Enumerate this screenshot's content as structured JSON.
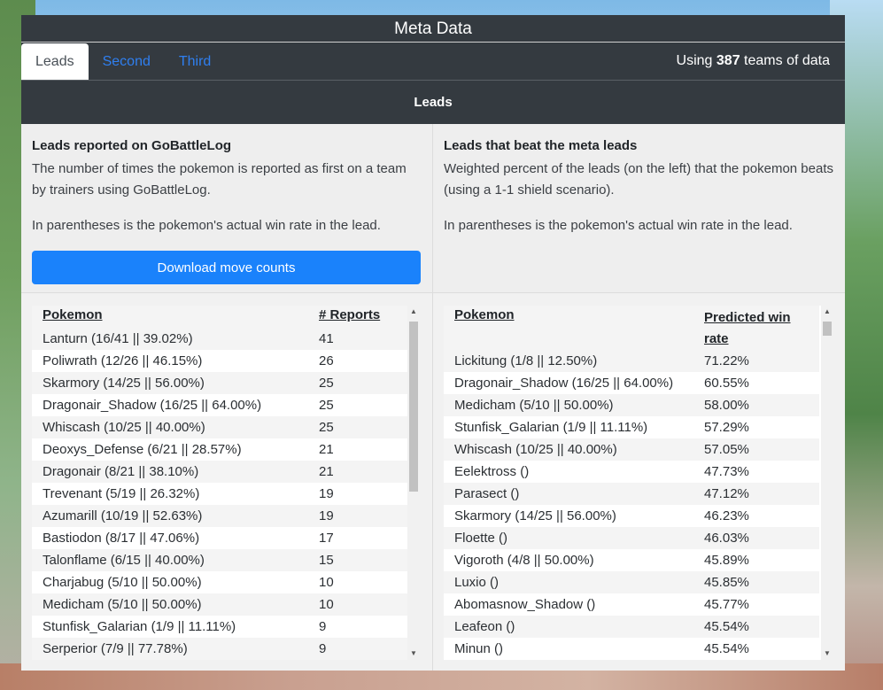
{
  "header": {
    "title": "Meta Data"
  },
  "tabs": [
    {
      "label": "Leads"
    },
    {
      "label": "Second"
    },
    {
      "label": "Third"
    }
  ],
  "teams_info": {
    "prefix": "Using",
    "count": "387",
    "suffix": "teams of data"
  },
  "section": {
    "title": "Leads"
  },
  "left": {
    "heading": "Leads reported on GoBattleLog",
    "desc1": "The number of times the pokemon is reported as first on a team by trainers using GoBattleLog.",
    "desc2": "In parentheses is the pokemon's actual win rate in the lead.",
    "download_label": "Download move counts",
    "columns": [
      "Pokemon",
      "# Reports"
    ],
    "rows": [
      [
        "Lanturn (16/41 || 39.02%)",
        "41"
      ],
      [
        "Poliwrath (12/26 || 46.15%)",
        "26"
      ],
      [
        "Skarmory (14/25 || 56.00%)",
        "25"
      ],
      [
        "Dragonair_Shadow (16/25 || 64.00%)",
        "25"
      ],
      [
        "Whiscash (10/25 || 40.00%)",
        "25"
      ],
      [
        "Deoxys_Defense (6/21 || 28.57%)",
        "21"
      ],
      [
        "Dragonair (8/21 || 38.10%)",
        "21"
      ],
      [
        "Trevenant (5/19 || 26.32%)",
        "19"
      ],
      [
        "Azumarill (10/19 || 52.63%)",
        "19"
      ],
      [
        "Bastiodon (8/17 || 47.06%)",
        "17"
      ],
      [
        "Talonflame (6/15 || 40.00%)",
        "15"
      ],
      [
        "Charjabug (5/10 || 50.00%)",
        "10"
      ],
      [
        "Medicham (5/10 || 50.00%)",
        "10"
      ],
      [
        "Stunfisk_Galarian (1/9 || 11.11%)",
        "9"
      ],
      [
        "Serperior (7/9 || 77.78%)",
        "9"
      ]
    ]
  },
  "right": {
    "heading": "Leads that beat the meta leads",
    "desc1": "Weighted percent of the leads (on the left) that the pokemon beats (using a 1-1 shield scenario).",
    "desc2": "In parentheses is the pokemon's actual win rate in the lead.",
    "columns": [
      "Pokemon",
      "Predicted win rate"
    ],
    "rows": [
      [
        "Lickitung (1/8 || 12.50%)",
        "71.22%"
      ],
      [
        "Dragonair_Shadow (16/25 || 64.00%)",
        "60.55%"
      ],
      [
        "Medicham (5/10 || 50.00%)",
        "58.00%"
      ],
      [
        "Stunfisk_Galarian (1/9 || 11.11%)",
        "57.29%"
      ],
      [
        "Whiscash (10/25 || 40.00%)",
        "57.05%"
      ],
      [
        "Eelektross ()",
        "47.73%"
      ],
      [
        "Parasect ()",
        "47.12%"
      ],
      [
        "Skarmory (14/25 || 56.00%)",
        "46.23%"
      ],
      [
        "Floette ()",
        "46.03%"
      ],
      [
        "Vigoroth (4/8 || 50.00%)",
        "45.89%"
      ],
      [
        "Luxio ()",
        "45.85%"
      ],
      [
        "Abomasnow_Shadow ()",
        "45.77%"
      ],
      [
        "Leafeon ()",
        "45.54%"
      ],
      [
        "Minun ()",
        "45.54%"
      ]
    ]
  }
}
